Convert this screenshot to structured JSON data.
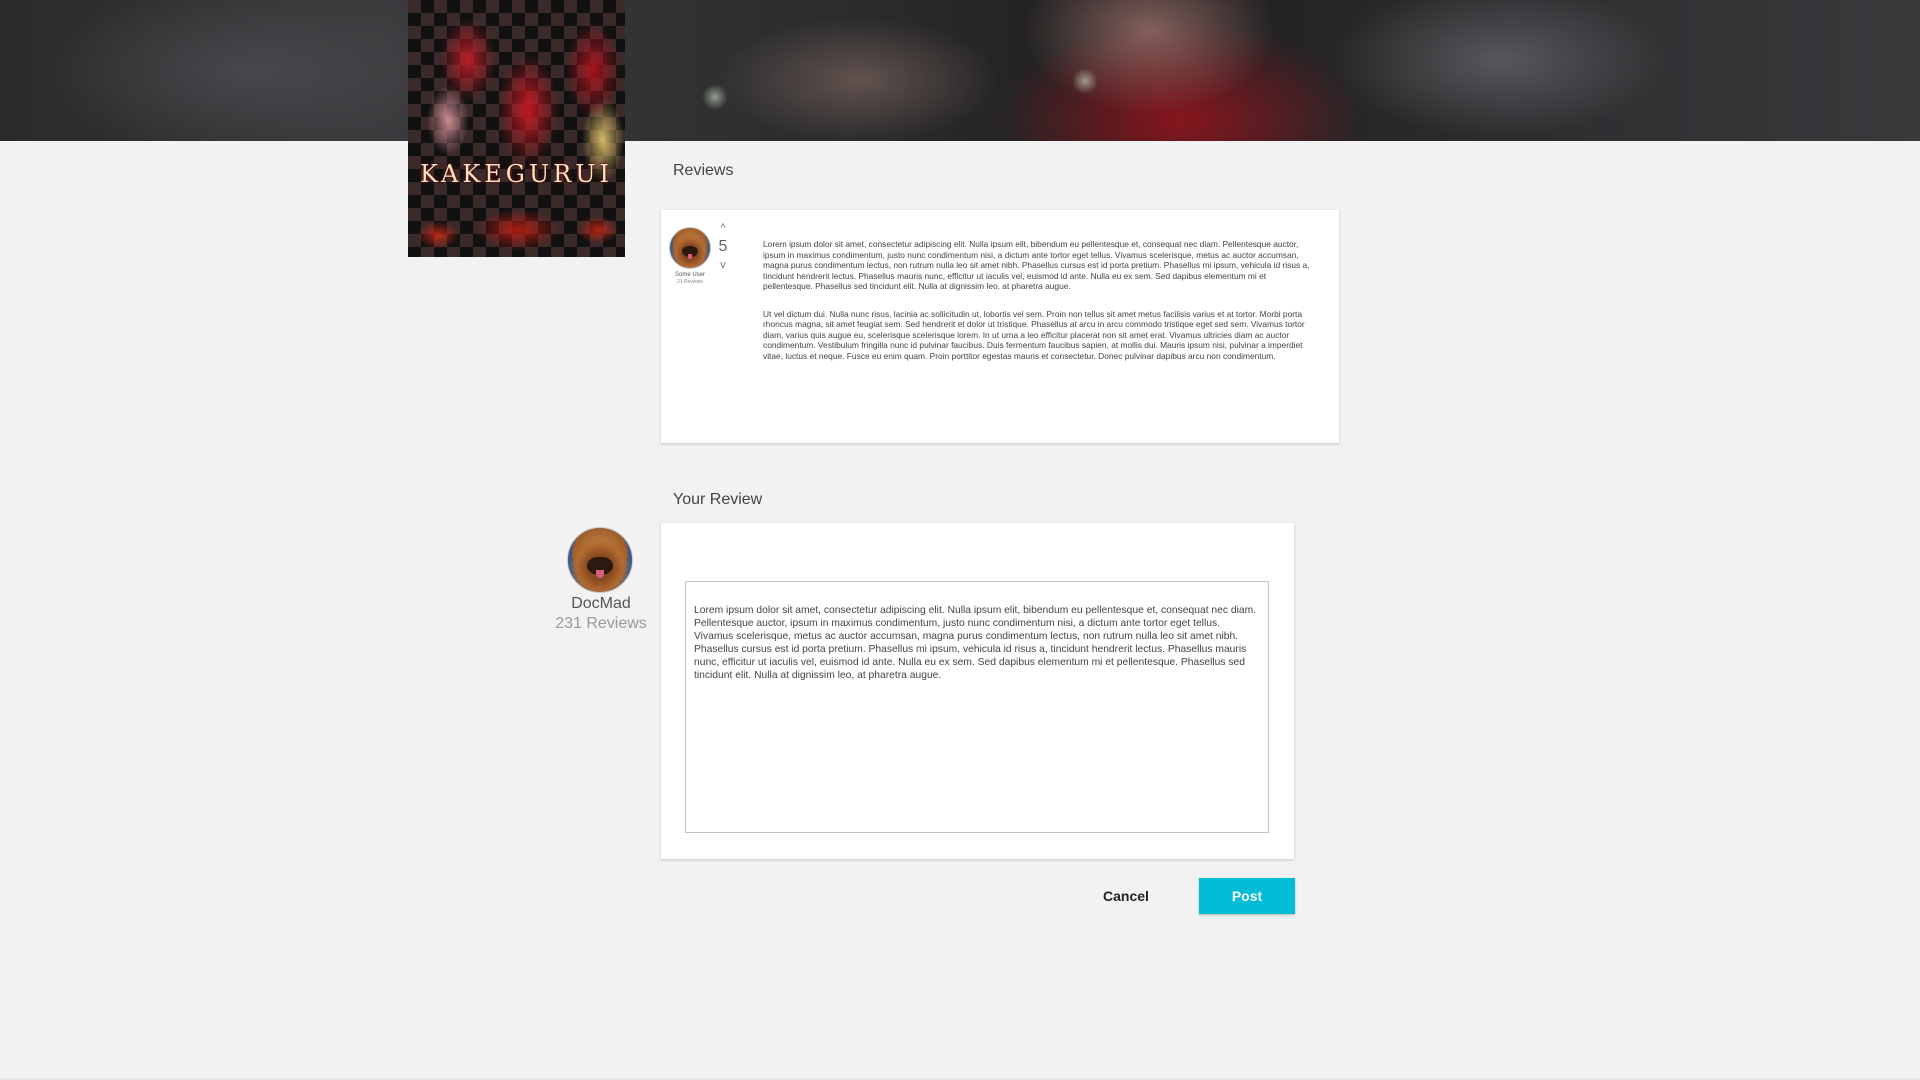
{
  "poster": {
    "title": "KAKEGURUI"
  },
  "reviews": {
    "heading": "Reviews",
    "items": [
      {
        "user_name": "Some User",
        "user_review_count": "21 Reviews",
        "score": "5",
        "vote_up_glyph": "^",
        "vote_down_glyph": "v",
        "paragraphs": [
          "Lorem ipsum dolor sit amet, consectetur adipiscing elit. Nulla ipsum elit, bibendum eu pellentesque et, consequat nec diam. Pellentesque auctor, ipsum in maximus condimentum, justo nunc condimentum nisi, a dictum ante tortor eget tellus. Vivamus scelerisque, metus ac auctor accumsan, magna purus condimentum lectus, non rutrum nulla leo sit amet nibh. Phasellus cursus est id porta pretium. Phasellus mi ipsum, vehicula id risus a, tincidunt hendrerit lectus. Phasellus mauris nunc, efficitur ut iaculis vel, euismod id ante. Nulla eu ex sem. Sed dapibus elementum mi et pellentesque. Phasellus sed tincidunt elit. Nulla at dignissim leo, at pharetra augue.",
          "Ut vel dictum dui. Nulla nunc risus, lacinia ac sollicitudin ut, lobortis vel sem. Proin non tellus sit amet metus facilisis varius et at tortor. Morbi porta rhoncus magna, sit amet feugiat sem. Sed hendrerit et dolor ut tristique. Phasellus at arcu in arcu commodo tristique eget sed sem. Vivamus tortor diam, varius quis augue eu, scelerisque scelerisque lorem. In ut urna a leo efficitur placerat non sit amet erat. Vivamus ultricies diam ac auctor condimentum. Vestibulum fringilla nunc id pulvinar faucibus. Duis fermentum faucibus sapien, at mollis dui. Mauris ipsum nisi, pulvinar a imperdiet vitae, luctus et neque. Fusce eu enim quam. Proin porttitor egestas mauris et consectetur. Donec pulvinar dapibus arcu non condimentum."
        ]
      }
    ]
  },
  "your_review": {
    "heading": "Your Review",
    "user_name": "DocMad",
    "user_review_count": "231 Reviews",
    "text": "Lorem ipsum dolor sit amet, consectetur adipiscing elit. Nulla ipsum elit, bibendum eu pellentesque et, consequat nec diam. Pellentesque auctor, ipsum in maximus condimentum, justo nunc condimentum nisi, a dictum ante tortor eget tellus. Vivamus scelerisque, metus ac auctor accumsan, magna purus condimentum lectus, non rutrum nulla leo sit amet nibh. Phasellus cursus est id porta pretium. Phasellus mi ipsum, vehicula id risus a, tincidunt hendrerit lectus. Phasellus mauris nunc, efficitur ut iaculis vel, euismod id ante. Nulla eu ex sem. Sed dapibus elementum mi et pellentesque. Phasellus sed tincidunt elit. Nulla at dignissim leo, at pharetra augue.",
    "cancel_label": "Cancel",
    "post_label": "Post"
  },
  "colors": {
    "accent": "#00bcd4",
    "background": "#f2f2f2",
    "card": "#ffffff"
  }
}
